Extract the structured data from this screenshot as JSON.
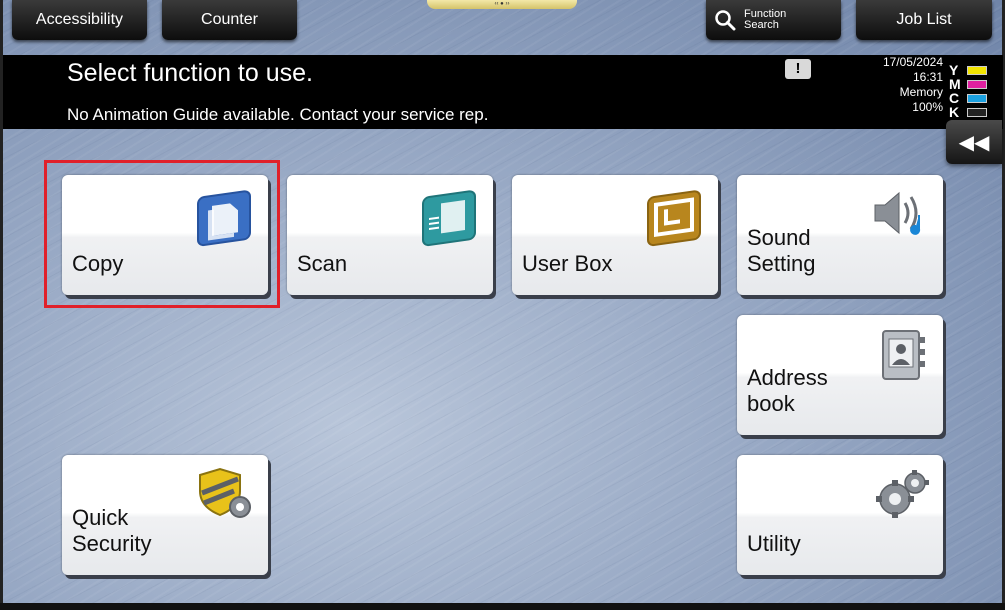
{
  "top_tabs": {
    "accessibility": "Accessibility",
    "counter": "Counter",
    "function_search_line1": "Function",
    "function_search_line2": "Search",
    "job_list": "Job List"
  },
  "message": {
    "title": "Select function to use.",
    "subtitle": "No Animation Guide available. Contact your service rep."
  },
  "status": {
    "date": "17/05/2024",
    "time": "16:31",
    "memory_label": "Memory",
    "memory_value": "100%",
    "toner": [
      {
        "letter": "Y",
        "color": "#f2e400"
      },
      {
        "letter": "M",
        "color": "#e020a0"
      },
      {
        "letter": "C",
        "color": "#1aa0e0"
      },
      {
        "letter": "K",
        "color": "#222222"
      }
    ]
  },
  "tiles": {
    "copy": "Copy",
    "scan": "Scan",
    "user_box": "User Box",
    "sound_line1": "Sound",
    "sound_line2": "Setting",
    "address_line1": "Address",
    "address_line2": "book",
    "quick_line1": "Quick",
    "quick_line2": "Security",
    "utility": "Utility"
  },
  "colors": {
    "highlight": "#e0202a",
    "copy_icon": "#3a6fc4",
    "scan_icon": "#2e9aa0",
    "userbox_icon": "#b8861e",
    "security_icon": "#e8c21a"
  }
}
